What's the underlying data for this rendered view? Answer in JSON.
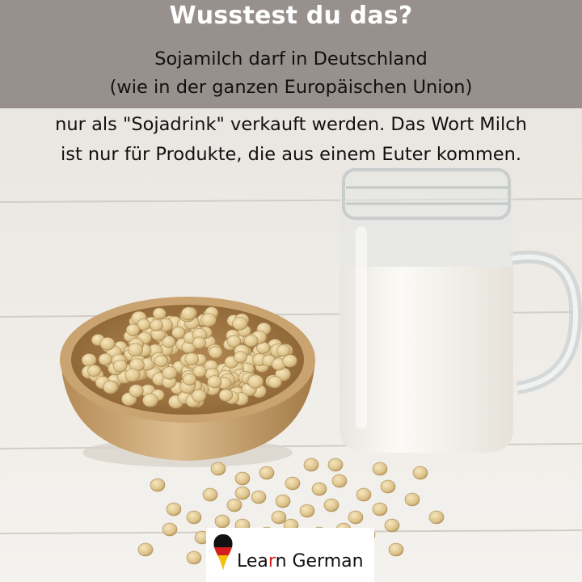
{
  "header": {
    "title": "Wusstest du das?",
    "lines": [
      "Sojamilch darf in Deutschland",
      "(wie in der ganzen Europäischen Union)",
      "nur als \"Sojadrink\" verkauft werden. Das Wort Milch",
      "ist nur für Produkte, die aus einem Euter kommen."
    ]
  },
  "logo": {
    "text_before": "Lea",
    "text_accent": "r",
    "text_after": "n German",
    "icon": "german-flag-pin-icon",
    "accent_color": "#d41f1f"
  },
  "colors": {
    "banner": "#948c88",
    "title_text": "#ffffff",
    "body_text": "#111111"
  }
}
